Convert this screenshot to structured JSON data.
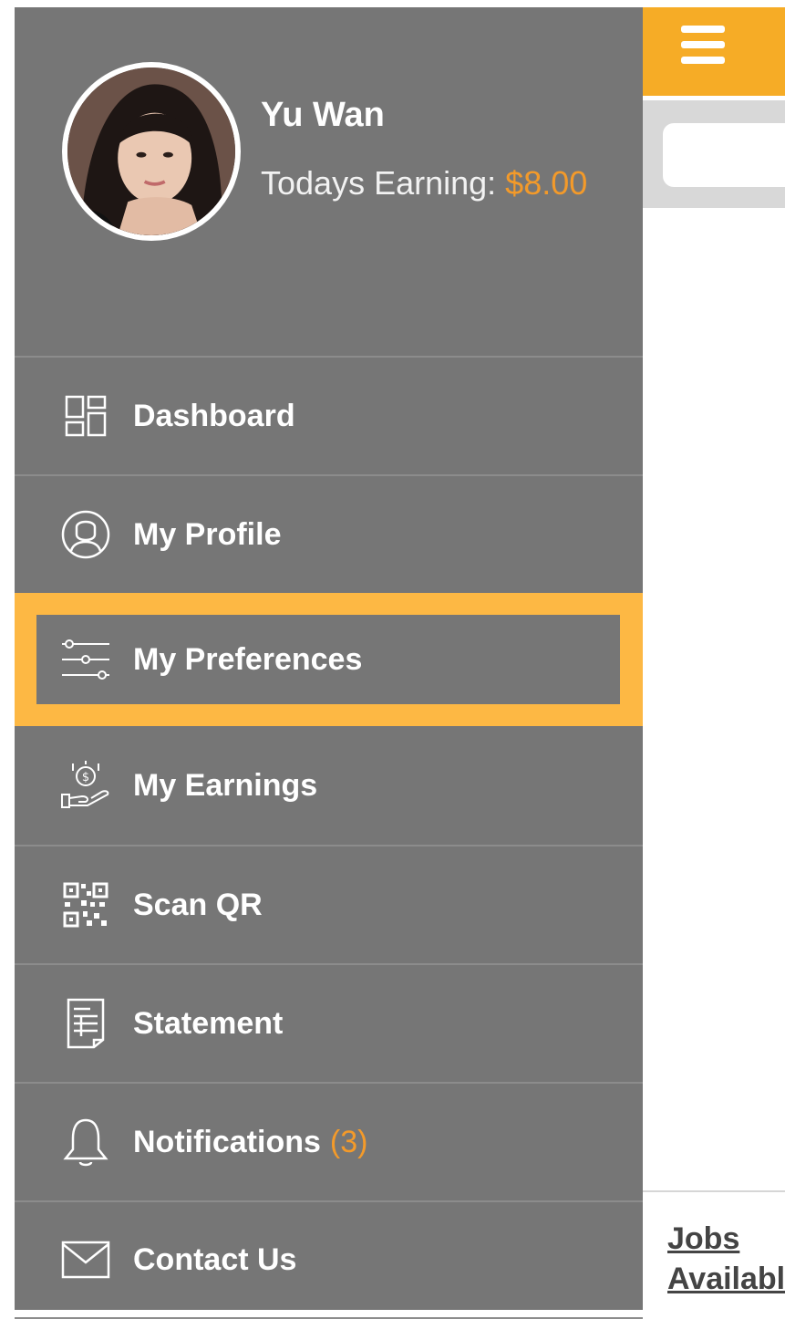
{
  "app": {
    "search_placeholder": "",
    "jobs_link": "Jobs Available"
  },
  "profile": {
    "name": "Yu Wan",
    "earning_label": "Todays Earning:",
    "earning_value": "$8.00"
  },
  "menu": {
    "items": [
      {
        "label": "Dashboard",
        "icon": "dashboard-icon"
      },
      {
        "label": "My Profile",
        "icon": "user-circle-icon"
      },
      {
        "label": "My Preferences",
        "icon": "sliders-icon",
        "active": true
      },
      {
        "label": "My Earnings",
        "icon": "hand-money-icon"
      },
      {
        "label": "Scan QR",
        "icon": "qr-code-icon"
      },
      {
        "label": "Statement",
        "icon": "statement-icon"
      },
      {
        "label": "Notifications",
        "icon": "bell-icon",
        "badge": "(3)"
      },
      {
        "label": "Contact Us",
        "icon": "envelope-icon"
      }
    ]
  },
  "colors": {
    "drawer_bg": "#767676",
    "accent_orange": "#F39A2A",
    "topbar_yellow": "#F6AC26",
    "active_highlight": "#FDB844"
  }
}
